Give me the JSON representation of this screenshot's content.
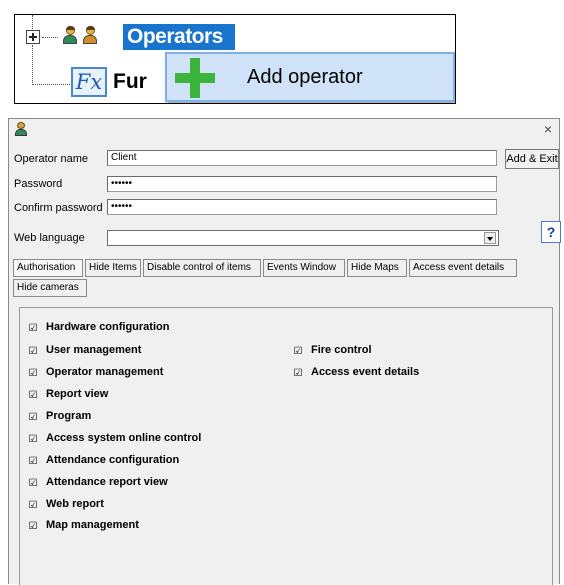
{
  "tree": {
    "operators_label": "Operators",
    "functions_icon": "Fx",
    "functions_label": "Fur"
  },
  "context_menu": {
    "add_operator_label": "Add operator"
  },
  "dialog": {
    "close_glyph": "×",
    "operator_name_label": "Operator name",
    "operator_name_value": "Client",
    "password_label": "Password",
    "password_value": "••••••",
    "confirm_password_label": "Confirm password",
    "confirm_password_value": "••••••",
    "web_language_label": "Web language",
    "web_language_value": "",
    "add_exit_label": "Add & Exit",
    "help_label": "?",
    "tabs": [
      "Authorisation",
      "Hide Items",
      "Disable control of items",
      "Events Window",
      "Hide Maps",
      "Access event details",
      "Hide cameras"
    ],
    "active_tab": "Authorisation",
    "permissions_left": [
      {
        "label": "Hardware configuration",
        "checked": true
      },
      {
        "label": "User management",
        "checked": true
      },
      {
        "label": "Operator management",
        "checked": true
      },
      {
        "label": "Report view",
        "checked": true
      },
      {
        "label": "Program",
        "checked": true
      },
      {
        "label": "Access system online control",
        "checked": true
      },
      {
        "label": "Attendance configuration",
        "checked": true
      },
      {
        "label": "Attendance report view",
        "checked": true
      },
      {
        "label": "Web report",
        "checked": true
      },
      {
        "label": "Map management",
        "checked": true
      }
    ],
    "permissions_right": [
      {
        "label": "Fire control",
        "checked": true
      },
      {
        "label": "Access event details",
        "checked": true
      }
    ],
    "check_glyph": "☑"
  },
  "colors": {
    "selection": "#1874cd",
    "menu_highlight": "#cfe2f7",
    "plus_green": "#3cb43c",
    "dialog_bg": "#f0f0f0"
  },
  "icons": {
    "tree_expander": "plus-box-icon",
    "operators": "operators-icon",
    "functions": "fx-icon",
    "add": "plus-icon",
    "title": "operator-icon",
    "close": "close-icon",
    "help": "help-icon",
    "dropdown": "chevron-down-icon"
  }
}
